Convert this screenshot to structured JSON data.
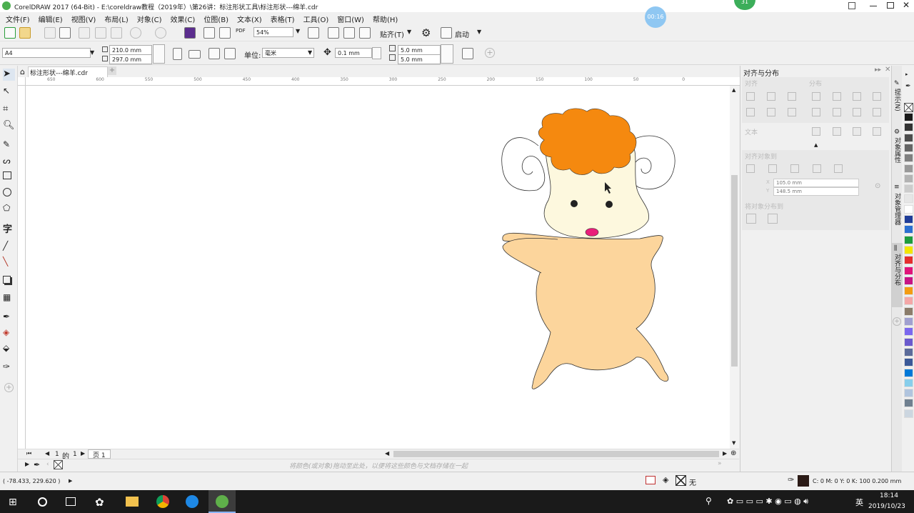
{
  "window": {
    "title": "CorelDRAW 2017 (64-Bit) - E:\\coreldraw教程（2019年）\\第26讲：标注形状工具\\标注形状---绵羊.cdr",
    "timer": "00:16",
    "badge": "31"
  },
  "menu": [
    "文件(F)",
    "编辑(E)",
    "视图(V)",
    "布局(L)",
    "对象(C)",
    "效果(C)",
    "位图(B)",
    "文本(X)",
    "表格(T)",
    "工具(O)",
    "窗口(W)",
    "帮助(H)"
  ],
  "toolbar": {
    "pdf_label": "PDF",
    "zoom": "54%",
    "snap_label": "贴齐(T)",
    "launch_label": "启动"
  },
  "propbar": {
    "page_size": "A4",
    "width": "210.0 mm",
    "height": "297.0 mm",
    "unit_label": "单位:",
    "unit": "毫米",
    "nudge": "0.1 mm",
    "dup_x": "5.0 mm",
    "dup_y": "5.0 mm"
  },
  "document_tab": "标注形状---绵羊.cdr",
  "ruler": {
    "h_ticks": [
      "650",
      "600",
      "550",
      "500",
      "450",
      "400",
      "350",
      "300",
      "250",
      "200",
      "150",
      "100",
      "50",
      "0"
    ],
    "unit_label": "毫米"
  },
  "page_nav": {
    "current": "1",
    "of_label": "的",
    "total": "1",
    "page_tab": "页 1"
  },
  "palette_hint": "将颜色(或对象)拖动至此处，以便将这些颜色与文档存储在一起",
  "status": {
    "coords": "( -78.433, 229.620 )",
    "fill_label": "无",
    "color_info": "C: 0 M: 0 Y: 0 K: 100  0.200 mm"
  },
  "docker": {
    "title": "对齐与分布",
    "align_label": "对齐",
    "distribute_label": "分布",
    "text_label": "文本",
    "align_objects_to": "对齐对象到",
    "x_value": "105.0 mm",
    "y_value": "148.5 mm",
    "distribute_to": "将对象分布到",
    "x_axis": "X",
    "y_axis": "Y"
  },
  "docker_tabs": [
    "提示(N)",
    "对象属性",
    "对象管理器",
    "对齐与分布"
  ],
  "palette_colors": [
    "#1a1a1a",
    "#333333",
    "#4d4d4d",
    "#666666",
    "#808080",
    "#999999",
    "#b3b3b3",
    "#cccccc",
    "#e6e6e6",
    "#ffffff",
    "#1f3d99",
    "#2b6fd1",
    "#1e9c3d",
    "#f2e600",
    "#e62e2e",
    "#e0157a",
    "#c71585",
    "#f39c12",
    "#f4a7a7",
    "#8b7d6b",
    "#a0a0d0",
    "#7b68ee",
    "#6a5acd",
    "#5b6b9a",
    "#3b5998",
    "#0078d7",
    "#87ceeb",
    "#b0c4de",
    "#708090",
    "#ccd6e0"
  ],
  "taskbar": {
    "ime": "英",
    "time": "18:14",
    "date": "2019/10/23"
  }
}
